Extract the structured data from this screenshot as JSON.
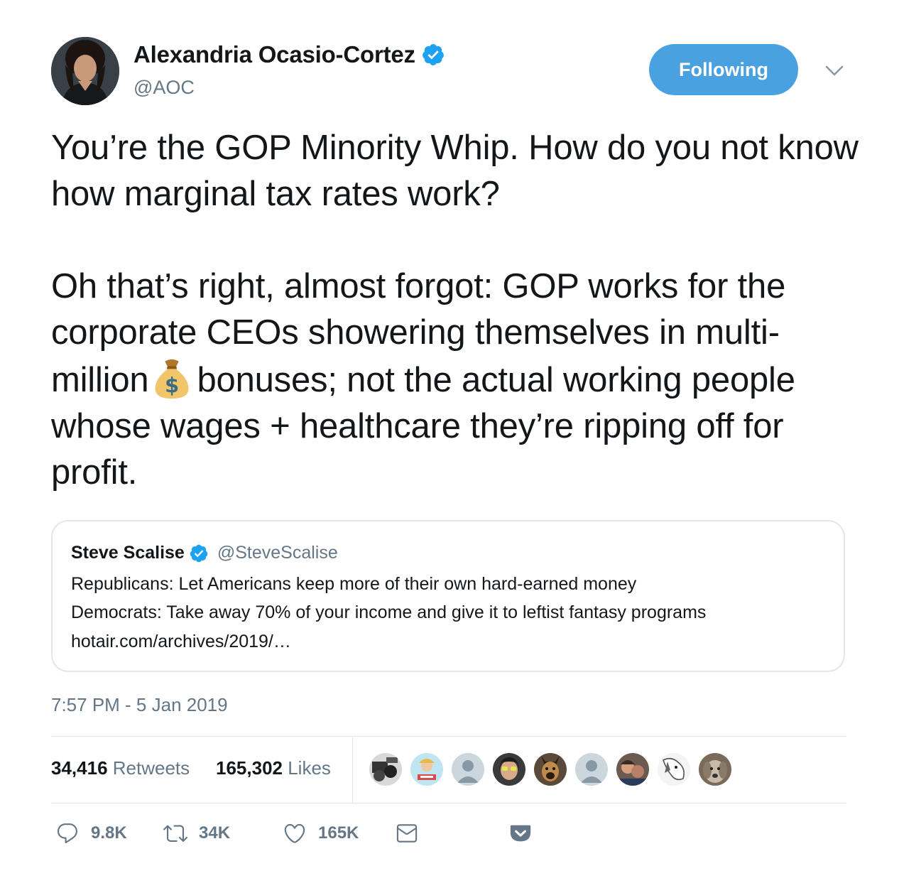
{
  "author": {
    "display_name": "Alexandria Ocasio-Cortez",
    "handle": "@AOC",
    "verified_icon": "verified-badge",
    "follow_button_label": "Following"
  },
  "tweet": {
    "paragraph1": "You’re the GOP Minority Whip. How do you not know how marginal tax rates work?",
    "paragraph2_part1": "Oh that’s right, almost forgot: GOP works for the corporate CEOs showering themselves in multi-million",
    "emoji": "money-bag",
    "paragraph2_part2": "bonuses; not the actual working people whose wages + healthcare they’re ripping off for profit.",
    "timestamp": "7:57 PM - 5 Jan 2019"
  },
  "quote": {
    "display_name": "Steve Scalise",
    "handle": "@SteveScalise",
    "line1": "Republicans: Let Americans keep more of their own hard-earned money",
    "line2": "Democrats: Take away 70% of your income and give it to leftist fantasy programs",
    "link": "hotair.com/archives/2019/…"
  },
  "stats": {
    "retweets_count": "34,416",
    "retweets_label": "Retweets",
    "likes_count": "165,302",
    "likes_label": "Likes"
  },
  "liker_avatars": [
    "liker-avatar-1",
    "liker-avatar-2",
    "liker-avatar-3",
    "liker-avatar-4",
    "liker-avatar-5",
    "liker-avatar-6",
    "liker-avatar-7",
    "liker-avatar-8",
    "liker-avatar-9"
  ],
  "actions": {
    "reply_count": "9.8K",
    "retweet_count": "34K",
    "like_count": "165K"
  },
  "colors": {
    "accent": "#4aa1e0",
    "text": "#14171a",
    "muted": "#657786",
    "border": "#e1e8ed",
    "verified": "#1da1f2"
  }
}
